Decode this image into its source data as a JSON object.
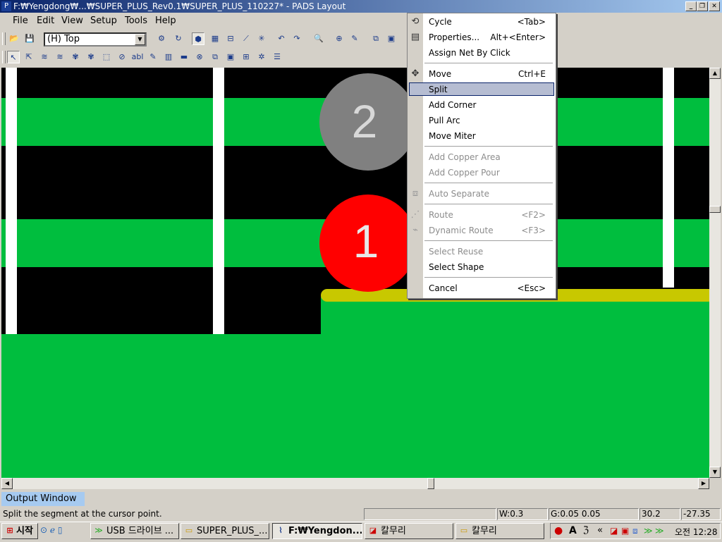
{
  "window": {
    "title": "F:₩Yengdong₩...₩SUPER_PLUS_Rev0.1₩SUPER_PLUS_110227* - PADS Layout",
    "caption_buttons": [
      "minimize-icon",
      "restore-icon",
      "close-icon"
    ]
  },
  "menubar": {
    "items": [
      "File",
      "Edit",
      "View",
      "Setup",
      "Tools",
      "Help"
    ]
  },
  "toolbar": {
    "layer_select": "(H) Top"
  },
  "canvas": {
    "colors": {
      "background": "#000000",
      "copper": "#00be3e",
      "trace_highlight": "#c8c800",
      "pad_selected": "#ff0000",
      "pad_other": "#808080",
      "keepout": "#ffffff"
    },
    "pads": [
      {
        "label": "2",
        "state": "unselected"
      },
      {
        "label": "1",
        "state": "selected"
      }
    ]
  },
  "context_menu": {
    "items": [
      {
        "label": "Cycle",
        "shortcut": "<Tab>",
        "icon": "cycle-icon",
        "enabled": true
      },
      {
        "label": "Properties...",
        "shortcut": "Alt+<Enter>",
        "icon": "properties-icon",
        "enabled": true
      },
      {
        "label": "Assign Net By Click",
        "shortcut": "",
        "icon": "",
        "enabled": true
      },
      {
        "label": "Move",
        "shortcut": "Ctrl+E",
        "icon": "move-icon",
        "enabled": true
      },
      {
        "label": "Split",
        "shortcut": "",
        "icon": "",
        "enabled": true,
        "selected": true
      },
      {
        "label": "Add Corner",
        "shortcut": "",
        "icon": "",
        "enabled": true
      },
      {
        "label": "Pull Arc",
        "shortcut": "",
        "icon": "",
        "enabled": true
      },
      {
        "label": "Move Miter",
        "shortcut": "",
        "icon": "",
        "enabled": true
      },
      {
        "label": "Add Copper Area",
        "shortcut": "",
        "icon": "",
        "enabled": false
      },
      {
        "label": "Add Copper Pour",
        "shortcut": "",
        "icon": "",
        "enabled": false
      },
      {
        "label": "Auto Separate",
        "shortcut": "",
        "icon": "auto-separate-icon",
        "enabled": false
      },
      {
        "label": "Route",
        "shortcut": "<F2>",
        "icon": "route-icon",
        "enabled": false
      },
      {
        "label": "Dynamic Route",
        "shortcut": "<F3>",
        "icon": "dynamic-route-icon",
        "enabled": false
      },
      {
        "label": "Select Reuse",
        "shortcut": "",
        "icon": "",
        "enabled": false
      },
      {
        "label": "Select Shape",
        "shortcut": "",
        "icon": "",
        "enabled": true
      },
      {
        "label": "Cancel",
        "shortcut": "<Esc>",
        "icon": "",
        "enabled": true
      }
    ]
  },
  "output_window": {
    "tab_label": "Output Window"
  },
  "status": {
    "message": "Split the segment at the cursor point.",
    "width": "W:0.3",
    "grid": "G:0.05 0.05",
    "x": "30.2",
    "y": "-27.35"
  },
  "taskbar": {
    "start_label": "시작",
    "tasks": [
      {
        "label": "USB 드라이브 ...",
        "icon": "app-icon",
        "active": false
      },
      {
        "label": "SUPER_PLUS_...",
        "icon": "folder-icon",
        "active": false
      },
      {
        "label": "F:₩Yengdon...",
        "icon": "pads-icon",
        "active": true
      },
      {
        "label": "칼무리",
        "icon": "app-icon",
        "active": false
      },
      {
        "label": "칼무리",
        "icon": "folder-icon",
        "active": false
      }
    ],
    "ime_label": "A",
    "clock": "오전 12:28"
  }
}
